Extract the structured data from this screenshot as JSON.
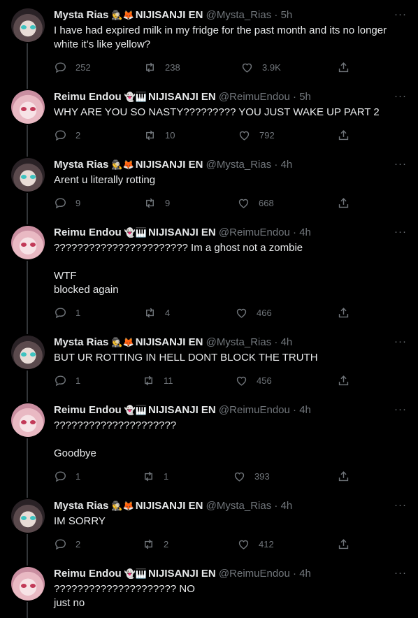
{
  "tweets": [
    {
      "author": "Mysta Rias",
      "badges": "🕵️🦊",
      "affiliation": "NIJISANJI EN",
      "handle": "@Mysta_Rias",
      "time": "5h",
      "text": "I have had expired milk in my fridge for the past month and its no longer white it’s like yellow?",
      "replies": "252",
      "retweets": "238",
      "likes": "3.9K",
      "avatar": "mysta"
    },
    {
      "author": "Reimu Endou",
      "badges": "👻🎹",
      "affiliation": "NIJISANJI EN",
      "handle": "@ReimuEndou",
      "time": "5h",
      "text": "WHY ARE YOU SO NASTY????????? YOU JUST WAKE UP PART 2",
      "replies": "2",
      "retweets": "10",
      "likes": "792",
      "avatar": "reimu"
    },
    {
      "author": "Mysta Rias",
      "badges": "🕵️🦊",
      "affiliation": "NIJISANJI EN",
      "handle": "@Mysta_Rias",
      "time": "4h",
      "text": "Arent u literally rotting",
      "replies": "9",
      "retweets": "9",
      "likes": "668",
      "avatar": "mysta"
    },
    {
      "author": "Reimu Endou",
      "badges": "👻🎹",
      "affiliation": "NIJISANJI EN",
      "handle": "@ReimuEndou",
      "time": "4h",
      "text": "??????????????????????? Im a ghost not a zombie\n\nWTF\nblocked again",
      "replies": "1",
      "retweets": "4",
      "likes": "466",
      "avatar": "reimu"
    },
    {
      "author": "Mysta Rias",
      "badges": "🕵️🦊",
      "affiliation": "NIJISANJI EN",
      "handle": "@Mysta_Rias",
      "time": "4h",
      "text": "BUT UR ROTTING IN HELL DONT BLOCK THE TRUTH",
      "replies": "1",
      "retweets": "11",
      "likes": "456",
      "avatar": "mysta"
    },
    {
      "author": "Reimu Endou",
      "badges": "👻🎹",
      "affiliation": "NIJISANJI EN",
      "handle": "@ReimuEndou",
      "time": "4h",
      "text": "?????????????????????\n\nGoodbye",
      "replies": "1",
      "retweets": "1",
      "likes": "393",
      "avatar": "reimu"
    },
    {
      "author": "Mysta Rias",
      "badges": "🕵️🦊",
      "affiliation": "NIJISANJI EN",
      "handle": "@Mysta_Rias",
      "time": "4h",
      "text": "IM SORRY",
      "replies": "2",
      "retweets": "2",
      "likes": "412",
      "avatar": "mysta"
    },
    {
      "author": "Reimu Endou",
      "badges": "👻🎹",
      "affiliation": "NIJISANJI EN",
      "handle": "@ReimuEndou",
      "time": "4h",
      "text": "????????????????????? NO\njust no",
      "replies": "",
      "retweets": "",
      "likes": "",
      "avatar": "reimu"
    }
  ],
  "dot": "·",
  "more_glyph": "···"
}
